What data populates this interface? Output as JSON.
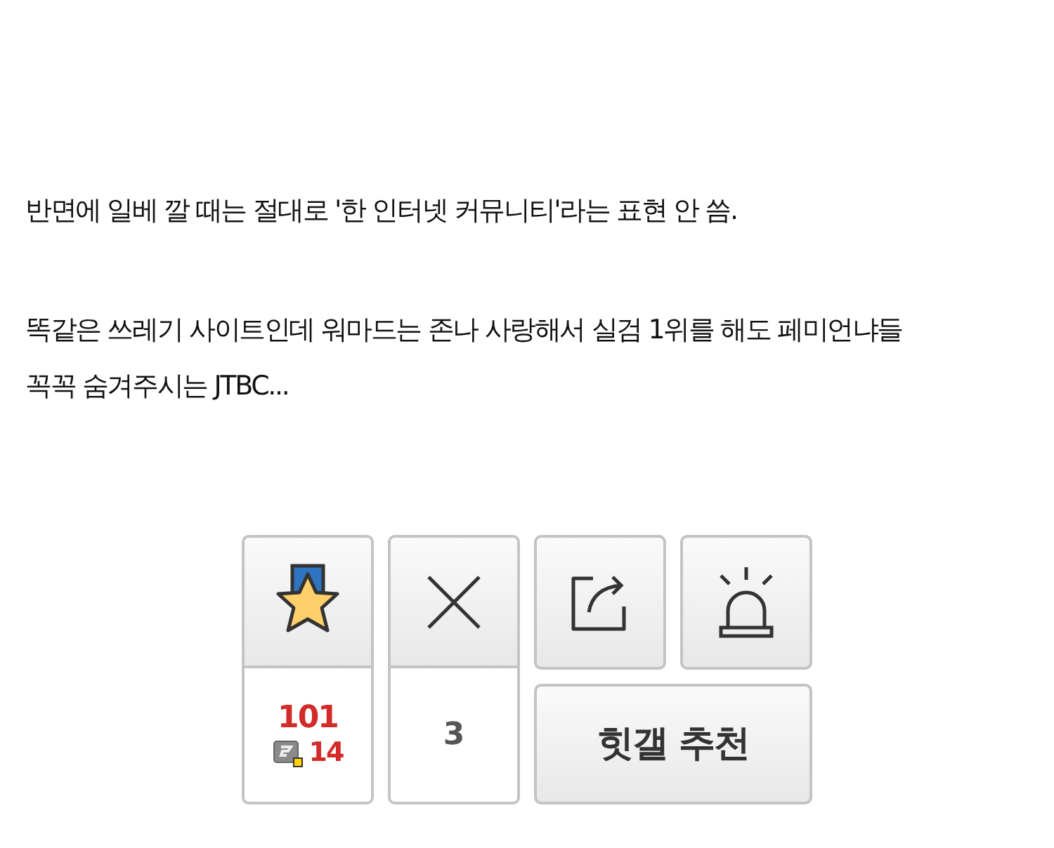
{
  "paragraphs": [
    {
      "lines": [
        "반면에 일베 깔 때는 절대로 '한 인터넷 커뮤니티'라는 표현 안 씀."
      ]
    },
    {
      "lines": [
        "똑같은 쓰레기 사이트인데 워마드는 존나 사랑해서 실검 1위를 해도 페미언냐들",
        "꼭꼭 숨겨주시는 JTBC..."
      ]
    }
  ],
  "recommend": {
    "count": "101",
    "fixed_count": "14"
  },
  "dislike": {
    "count": "3"
  },
  "hit_button": {
    "label": "힛갤 추천"
  }
}
